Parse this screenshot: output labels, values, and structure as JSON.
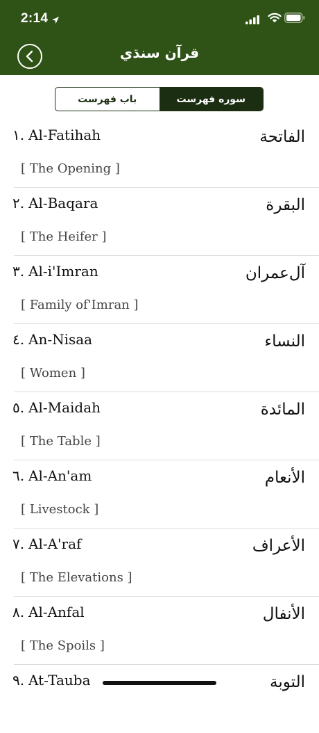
{
  "status_bar": {
    "time": "2:14"
  },
  "nav": {
    "title": "قرآن سنڌي"
  },
  "tabs": {
    "chapter_index": "باب فهرست",
    "surah_index": "سوره فهرست"
  },
  "surahs": [
    {
      "number": "١.",
      "name": "Al-Fatihah",
      "meaning": "[ The Opening ]",
      "arabic": "الفاتحة"
    },
    {
      "number": "٢.",
      "name": "Al-Baqara",
      "meaning": "[ The Heifer ]",
      "arabic": "البقرة"
    },
    {
      "number": "٣.",
      "name": "Al-i'Imran",
      "meaning": "[ Family of'Imran ]",
      "arabic": "آل‌عمران"
    },
    {
      "number": "٤.",
      "name": "An-Nisaa",
      "meaning": "[ Women ]",
      "arabic": "النساء"
    },
    {
      "number": "٥.",
      "name": "Al-Maidah",
      "meaning": "[ The Table ]",
      "arabic": "المائدة"
    },
    {
      "number": "٦.",
      "name": "Al-An'am",
      "meaning": "[ Livestock ]",
      "arabic": "الأنعام"
    },
    {
      "number": "٧.",
      "name": "Al-A'raf",
      "meaning": "[ The Elevations ]",
      "arabic": "الأعراف"
    },
    {
      "number": "٨.",
      "name": "Al-Anfal",
      "meaning": "[ The Spoils ]",
      "arabic": "الأنفال"
    },
    {
      "number": "٩.",
      "name": "At-Tauba",
      "meaning": "",
      "arabic": "التوبة"
    }
  ]
}
